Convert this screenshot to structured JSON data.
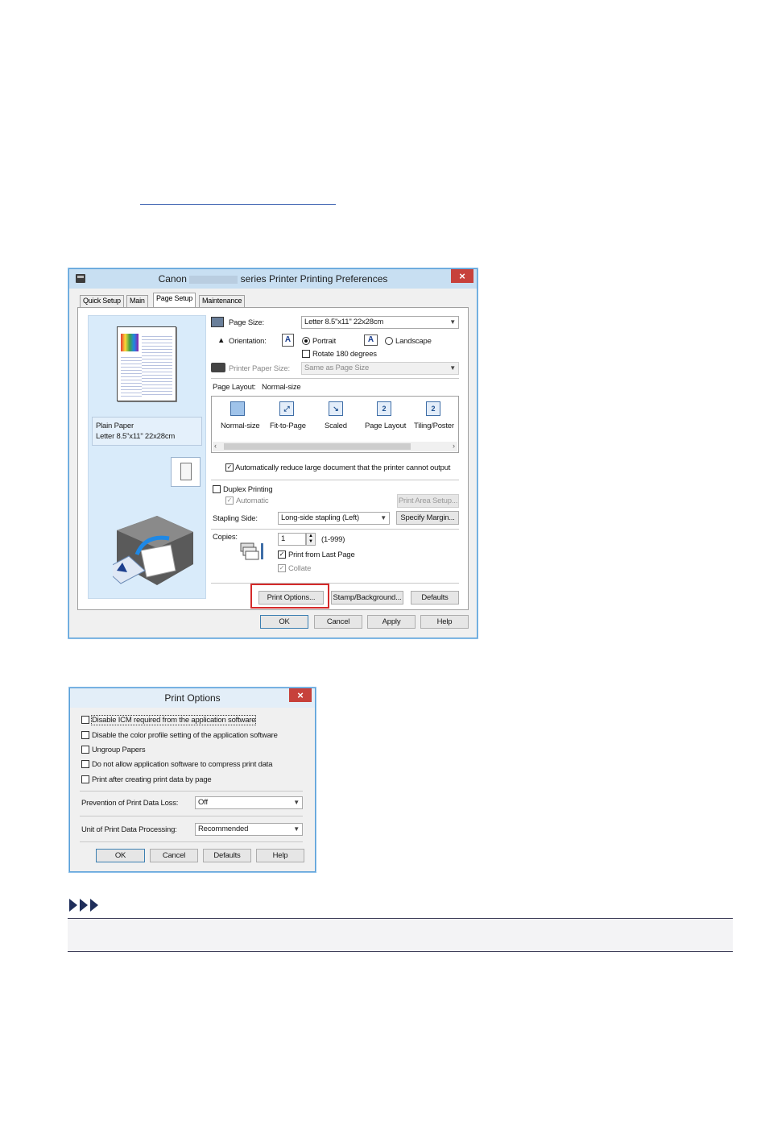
{
  "main_dialog": {
    "title_prefix": "Canon",
    "title_suffix": "series Printer Printing Preferences",
    "close": "×",
    "tabs": [
      "Quick Setup",
      "Main",
      "Page Setup",
      "Maintenance"
    ],
    "active_tab": "Page Setup",
    "preview": {
      "media_type": "Plain Paper",
      "paper_size": "Letter 8.5\"x11\" 22x28cm"
    },
    "page_size_label": "Page Size:",
    "page_size_value": "Letter 8.5\"x11\" 22x28cm",
    "orientation_label": "Orientation:",
    "portrait_label": "Portrait",
    "landscape_label": "Landscape",
    "orientation_value": "Portrait",
    "rotate_label": "Rotate 180 degrees",
    "printer_paper_size_label": "Printer Paper Size:",
    "printer_paper_size_value": "Same as Page Size",
    "page_layout_label": "Page Layout:",
    "page_layout_value": "Normal-size",
    "layout_options": [
      "Normal-size",
      "Fit-to-Page",
      "Scaled",
      "Page Layout",
      "Tiling/Poster"
    ],
    "auto_reduce_label": "Automatically reduce large document that the printer cannot output",
    "duplex_label": "Duplex Printing",
    "automatic_label": "Automatic",
    "print_area_setup_label": "Print Area Setup...",
    "stapling_side_label": "Stapling Side:",
    "stapling_side_value": "Long-side stapling (Left)",
    "specify_margin_label": "Specify Margin...",
    "copies_label": "Copies:",
    "copies_value": "1",
    "copies_range": "(1-999)",
    "print_from_last_label": "Print from Last Page",
    "collate_label": "Collate",
    "print_options_label": "Print Options...",
    "stamp_background_label": "Stamp/Background...",
    "defaults_label": "Defaults",
    "ok_label": "OK",
    "cancel_label": "Cancel",
    "apply_label": "Apply",
    "help_label": "Help"
  },
  "print_options_dialog": {
    "title": "Print Options",
    "close": "×",
    "checkboxes": [
      "Disable ICM required from the application software",
      "Disable the color profile setting of the application software",
      "Ungroup Papers",
      "Do not allow application software to compress print data",
      "Print after creating print data by page"
    ],
    "prevention_label": "Prevention of Print Data Loss:",
    "prevention_value": "Off",
    "unit_label": "Unit of Print Data Processing:",
    "unit_value": "Recommended",
    "ok_label": "OK",
    "cancel_label": "Cancel",
    "defaults_label": "Defaults",
    "help_label": "Help"
  },
  "colors": {
    "highlight": "#d42a2a",
    "titlebar": "#c8dff2",
    "close": "#c7413b",
    "note_border": "#40405a"
  }
}
